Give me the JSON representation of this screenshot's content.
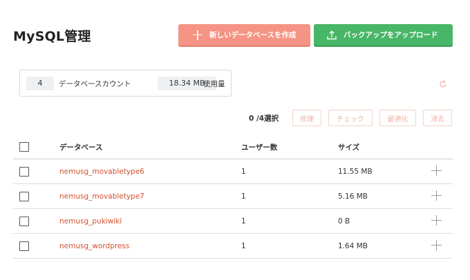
{
  "header": {
    "title": "MySQL管理",
    "create_label": "新しいデータベースを作成",
    "backup_label": "バックアップをアップロード"
  },
  "summary": {
    "db_count": "4",
    "db_count_label": "データベースカウント",
    "usage": "18.34 MB",
    "usage_label": "使用量"
  },
  "actions": {
    "selection": "0 /4選択",
    "repair": "修理",
    "check": "チェック",
    "optimize": "最適化",
    "delete": "消去"
  },
  "table": {
    "columns": {
      "name": "データベース",
      "users": "ユーザー数",
      "size": "サイズ"
    },
    "rows": [
      {
        "name": "nemusg_movabletype6",
        "users": "1",
        "size": "11.55 MB"
      },
      {
        "name": "nemusg_movabletype7",
        "users": "1",
        "size": "5.16 MB"
      },
      {
        "name": "nemusg_pukiwiki",
        "users": "1",
        "size": "0 B"
      },
      {
        "name": "nemusg_wordpress",
        "users": "1",
        "size": "1.64 MB"
      }
    ]
  },
  "colors": {
    "create_button": "#f59484",
    "backup_button": "#48b667",
    "db_link": "#d2512e"
  },
  "icons": {
    "create": "plus-icon",
    "backup": "upload-icon",
    "refresh": "refresh-icon",
    "expand": "plus-icon"
  }
}
